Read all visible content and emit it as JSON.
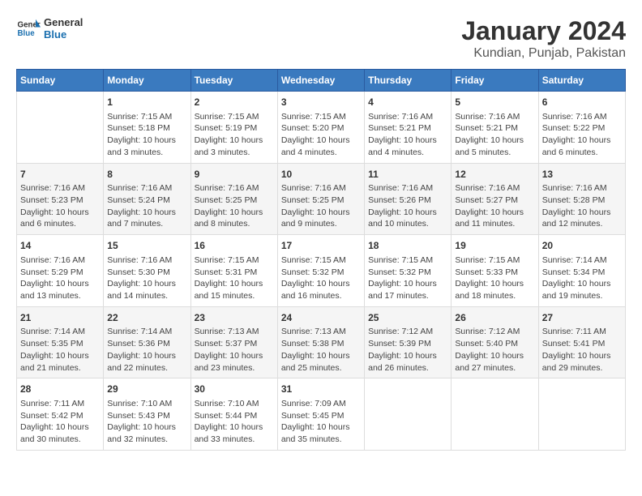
{
  "logo": {
    "general": "General",
    "blue": "Blue"
  },
  "title": "January 2024",
  "subtitle": "Kundian, Punjab, Pakistan",
  "headers": [
    "Sunday",
    "Monday",
    "Tuesday",
    "Wednesday",
    "Thursday",
    "Friday",
    "Saturday"
  ],
  "weeks": [
    [
      {
        "day": "",
        "info": ""
      },
      {
        "day": "1",
        "info": "Sunrise: 7:15 AM\nSunset: 5:18 PM\nDaylight: 10 hours\nand 3 minutes."
      },
      {
        "day": "2",
        "info": "Sunrise: 7:15 AM\nSunset: 5:19 PM\nDaylight: 10 hours\nand 3 minutes."
      },
      {
        "day": "3",
        "info": "Sunrise: 7:15 AM\nSunset: 5:20 PM\nDaylight: 10 hours\nand 4 minutes."
      },
      {
        "day": "4",
        "info": "Sunrise: 7:16 AM\nSunset: 5:21 PM\nDaylight: 10 hours\nand 4 minutes."
      },
      {
        "day": "5",
        "info": "Sunrise: 7:16 AM\nSunset: 5:21 PM\nDaylight: 10 hours\nand 5 minutes."
      },
      {
        "day": "6",
        "info": "Sunrise: 7:16 AM\nSunset: 5:22 PM\nDaylight: 10 hours\nand 6 minutes."
      }
    ],
    [
      {
        "day": "7",
        "info": "Sunrise: 7:16 AM\nSunset: 5:23 PM\nDaylight: 10 hours\nand 6 minutes."
      },
      {
        "day": "8",
        "info": "Sunrise: 7:16 AM\nSunset: 5:24 PM\nDaylight: 10 hours\nand 7 minutes."
      },
      {
        "day": "9",
        "info": "Sunrise: 7:16 AM\nSunset: 5:25 PM\nDaylight: 10 hours\nand 8 minutes."
      },
      {
        "day": "10",
        "info": "Sunrise: 7:16 AM\nSunset: 5:25 PM\nDaylight: 10 hours\nand 9 minutes."
      },
      {
        "day": "11",
        "info": "Sunrise: 7:16 AM\nSunset: 5:26 PM\nDaylight: 10 hours\nand 10 minutes."
      },
      {
        "day": "12",
        "info": "Sunrise: 7:16 AM\nSunset: 5:27 PM\nDaylight: 10 hours\nand 11 minutes."
      },
      {
        "day": "13",
        "info": "Sunrise: 7:16 AM\nSunset: 5:28 PM\nDaylight: 10 hours\nand 12 minutes."
      }
    ],
    [
      {
        "day": "14",
        "info": "Sunrise: 7:16 AM\nSunset: 5:29 PM\nDaylight: 10 hours\nand 13 minutes."
      },
      {
        "day": "15",
        "info": "Sunrise: 7:16 AM\nSunset: 5:30 PM\nDaylight: 10 hours\nand 14 minutes."
      },
      {
        "day": "16",
        "info": "Sunrise: 7:15 AM\nSunset: 5:31 PM\nDaylight: 10 hours\nand 15 minutes."
      },
      {
        "day": "17",
        "info": "Sunrise: 7:15 AM\nSunset: 5:32 PM\nDaylight: 10 hours\nand 16 minutes."
      },
      {
        "day": "18",
        "info": "Sunrise: 7:15 AM\nSunset: 5:32 PM\nDaylight: 10 hours\nand 17 minutes."
      },
      {
        "day": "19",
        "info": "Sunrise: 7:15 AM\nSunset: 5:33 PM\nDaylight: 10 hours\nand 18 minutes."
      },
      {
        "day": "20",
        "info": "Sunrise: 7:14 AM\nSunset: 5:34 PM\nDaylight: 10 hours\nand 19 minutes."
      }
    ],
    [
      {
        "day": "21",
        "info": "Sunrise: 7:14 AM\nSunset: 5:35 PM\nDaylight: 10 hours\nand 21 minutes."
      },
      {
        "day": "22",
        "info": "Sunrise: 7:14 AM\nSunset: 5:36 PM\nDaylight: 10 hours\nand 22 minutes."
      },
      {
        "day": "23",
        "info": "Sunrise: 7:13 AM\nSunset: 5:37 PM\nDaylight: 10 hours\nand 23 minutes."
      },
      {
        "day": "24",
        "info": "Sunrise: 7:13 AM\nSunset: 5:38 PM\nDaylight: 10 hours\nand 25 minutes."
      },
      {
        "day": "25",
        "info": "Sunrise: 7:12 AM\nSunset: 5:39 PM\nDaylight: 10 hours\nand 26 minutes."
      },
      {
        "day": "26",
        "info": "Sunrise: 7:12 AM\nSunset: 5:40 PM\nDaylight: 10 hours\nand 27 minutes."
      },
      {
        "day": "27",
        "info": "Sunrise: 7:11 AM\nSunset: 5:41 PM\nDaylight: 10 hours\nand 29 minutes."
      }
    ],
    [
      {
        "day": "28",
        "info": "Sunrise: 7:11 AM\nSunset: 5:42 PM\nDaylight: 10 hours\nand 30 minutes."
      },
      {
        "day": "29",
        "info": "Sunrise: 7:10 AM\nSunset: 5:43 PM\nDaylight: 10 hours\nand 32 minutes."
      },
      {
        "day": "30",
        "info": "Sunrise: 7:10 AM\nSunset: 5:44 PM\nDaylight: 10 hours\nand 33 minutes."
      },
      {
        "day": "31",
        "info": "Sunrise: 7:09 AM\nSunset: 5:45 PM\nDaylight: 10 hours\nand 35 minutes."
      },
      {
        "day": "",
        "info": ""
      },
      {
        "day": "",
        "info": ""
      },
      {
        "day": "",
        "info": ""
      }
    ]
  ]
}
